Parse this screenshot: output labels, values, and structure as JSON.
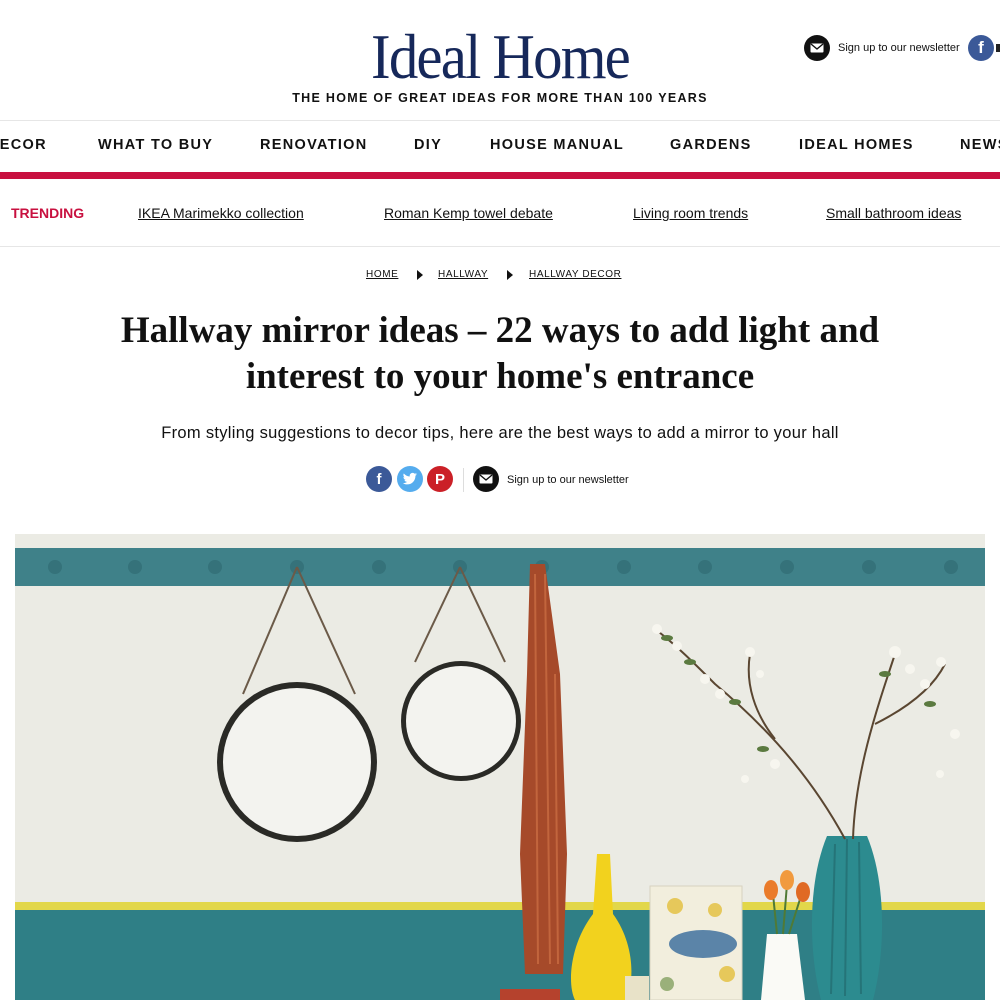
{
  "header": {
    "logo": "Ideal Home",
    "tagline": "THE HOME OF GREAT IDEAS FOR MORE THAN 100 YEARS",
    "newsletter_label": "Sign up to our newsletter"
  },
  "nav": {
    "items": [
      "DECOR",
      "WHAT TO BUY",
      "RENOVATION",
      "DIY",
      "HOUSE MANUAL",
      "GARDENS",
      "IDEAL HOMES",
      "NEWS"
    ]
  },
  "trending": {
    "label": "TRENDING",
    "links": [
      "IKEA Marimekko collection",
      "Roman Kemp towel debate",
      "Living room trends",
      "Small bathroom ideas"
    ]
  },
  "breadcrumb": [
    "HOME",
    "HALLWAY",
    "HALLWAY DECOR"
  ],
  "article": {
    "title_line1": "Hallway mirror ideas – 22 ways to add light and",
    "title_line2": "interest to your home's entrance",
    "standfirst": "From styling suggestions to decor tips, here are the best ways to add a mirror to your hall"
  },
  "share": {
    "facebook": "f",
    "twitter": "t",
    "pinterest": "P",
    "newsletter_label": "Sign up to our newsletter"
  },
  "colors": {
    "brand_navy": "#16285a",
    "accent_red": "#c8103f",
    "facebook": "#3b5998",
    "twitter": "#55acee",
    "pinterest": "#cb2027",
    "wall_teal": "#2f7f86"
  },
  "icons": {
    "newsletter": "envelope-icon",
    "facebook": "facebook-icon",
    "twitter": "twitter-icon",
    "pinterest": "pinterest-icon"
  }
}
